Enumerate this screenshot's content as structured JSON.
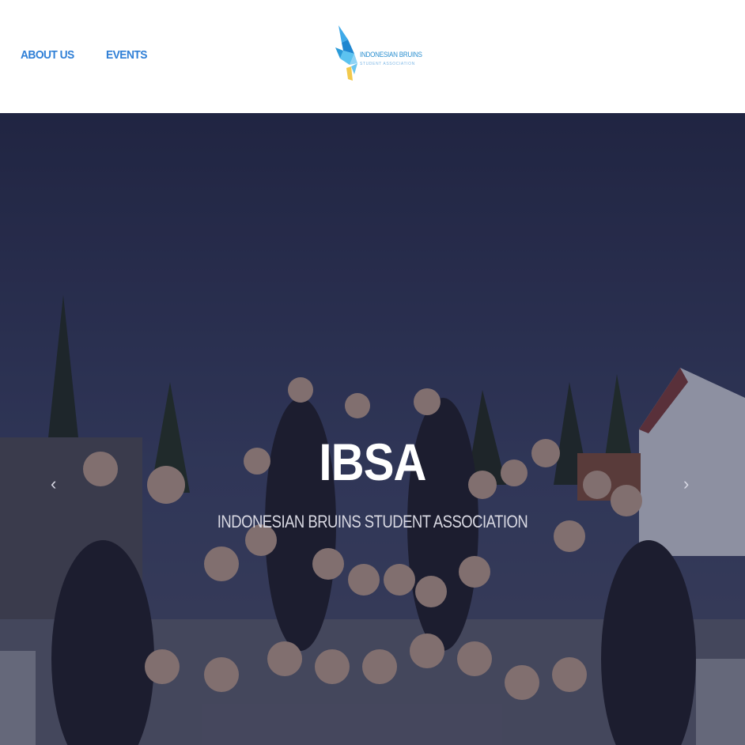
{
  "nav": {
    "items": [
      {
        "label": "ABOUT US"
      },
      {
        "label": "EVENTS"
      }
    ]
  },
  "logo": {
    "title": "INDONESIAN BRUINS",
    "subtitle": "STUDENT ASSOCIATION",
    "icon": "bird-logo-icon"
  },
  "hero": {
    "title": "IBSA",
    "subtitle": "INDONESIAN BRUINS STUDENT ASSOCIATION",
    "prev_icon": "chevron-left-icon",
    "next_icon": "chevron-right-icon",
    "prev_glyph": "‹",
    "next_glyph": "›"
  },
  "colors": {
    "nav_link": "#2f7fd6",
    "sky_top": "#232846",
    "sky_bottom": "#3a4266",
    "overlay": "rgba(30,32,60,0.35)"
  }
}
